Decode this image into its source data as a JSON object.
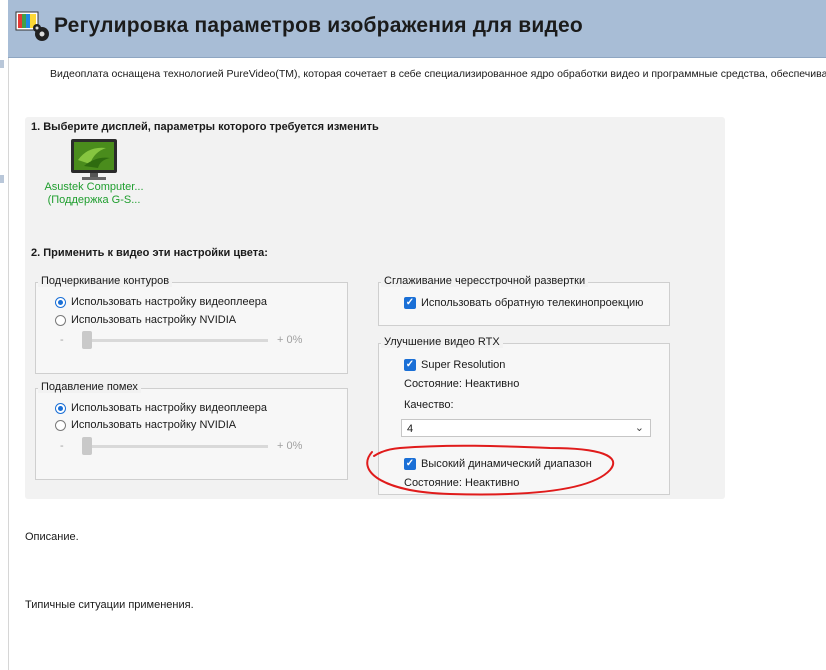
{
  "header": {
    "title": "Регулировка параметров изображения для видео",
    "icon": "nvidia-video-settings-icon"
  },
  "intro_text": "Видеоплата оснащена технологией PureVideo(TM), которая сочетает в себе специализированное ядро обработки видео и программные средства, обеспечива",
  "step1": {
    "title": "1. Выберите дисплей, параметры которого требуется изменить",
    "display": {
      "name_line1": "Asustek Computer...",
      "name_line2": "(Поддержка G-S..."
    }
  },
  "step2": {
    "title": "2. Применить к видео эти настройки цвета:"
  },
  "edge_enhancement": {
    "title": "Подчеркивание контуров",
    "options": [
      "Использовать настройку видеоплеера",
      "Использовать настройку NVIDIA"
    ],
    "selected": 0,
    "slider": {
      "minus": "-",
      "plus": "+ 0%",
      "value_percent": 0
    }
  },
  "noise_reduction": {
    "title": "Подавление помех",
    "options": [
      "Использовать настройку видеоплеера",
      "Использовать настройку NVIDIA"
    ],
    "selected": 0,
    "slider": {
      "minus": "-",
      "plus": "+ 0%",
      "value_percent": 0
    }
  },
  "deinterlacing": {
    "title": "Сглаживание чересстрочной развертки",
    "checkbox_label": "Использовать обратную телекинопроекцию",
    "checked": true
  },
  "rtx_video": {
    "title": "Улучшение видео RTX",
    "super_resolution_label": "Super Resolution",
    "super_resolution_checked": true,
    "sr_status": "Состояние: Неактивно",
    "quality_label": "Качество:",
    "quality_value": "4",
    "hdr_label": "Высокий динамический диапазон",
    "hdr_checked": true,
    "hdr_status": "Состояние: Неактивно"
  },
  "description_label": "Описание.",
  "typical_usage_label": "Типичные ситуации применения.",
  "colors": {
    "accent": "#1a6fd6",
    "header_bg": "#a8bdd6",
    "display_label": "#1f9e2e",
    "annotation": "#e01b1b"
  }
}
